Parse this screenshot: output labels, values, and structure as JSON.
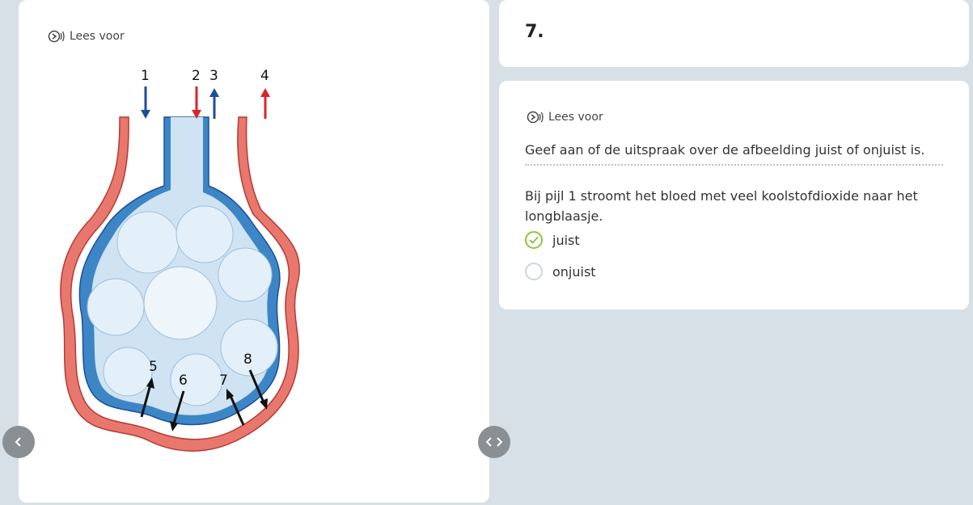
{
  "left_panel": {
    "read_aloud_label": "Lees voor",
    "figure": {
      "labels": [
        "1",
        "2",
        "3",
        "4",
        "5",
        "6",
        "7",
        "8"
      ],
      "colors": {
        "vein_blue": "#1d4e9a",
        "artery_red": "#d9252a",
        "vessel": "#e8786e",
        "alveolus": "#cfe3f3"
      }
    }
  },
  "question": {
    "number": "7.",
    "read_aloud_label": "Lees voor",
    "instruction": "Geef aan of de uitspraak over de afbeelding juist of onjuist is.",
    "statement": "Bij pijl 1 stroomt het bloed met veel koolstofdioxide naar het longblaasje.",
    "options": [
      {
        "label": "juist",
        "selected": true
      },
      {
        "label": "onjuist",
        "selected": false
      }
    ]
  },
  "colors": {
    "background": "#d6e0e6",
    "card": "#ffffff",
    "accent_green": "#8cc63f",
    "nav_button": "#8a8f93"
  }
}
